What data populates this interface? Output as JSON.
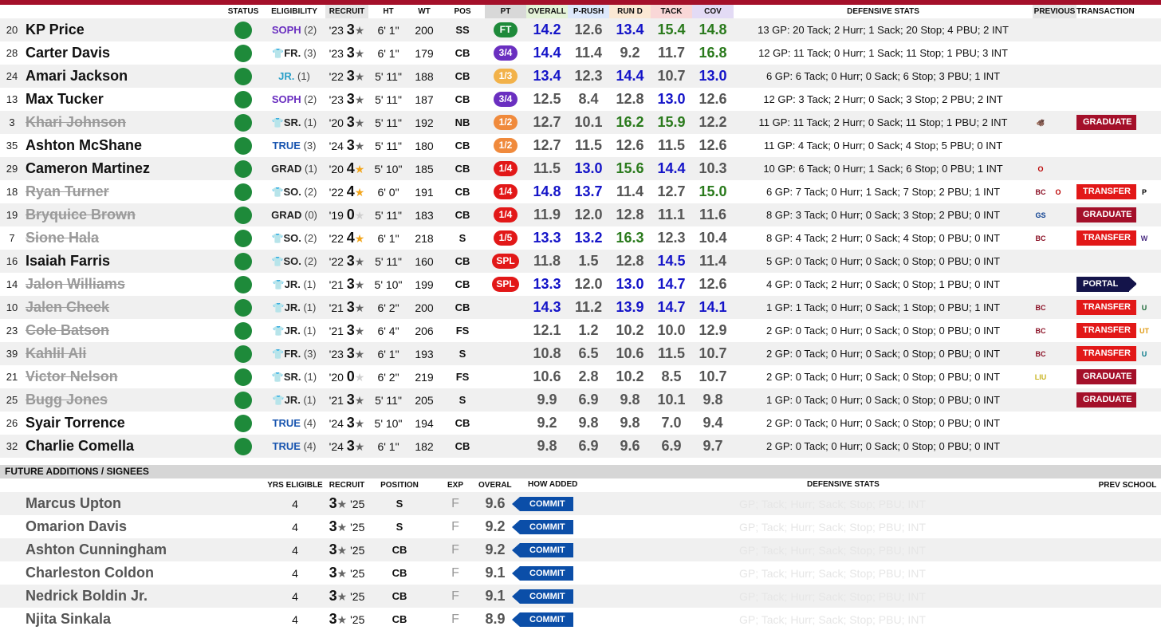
{
  "roster_headers": {
    "status": "STATUS",
    "eligibility": "ELIGIBILITY",
    "recruit": "RECRUIT",
    "ht": "HT",
    "wt": "WT",
    "pos": "POS",
    "pt": "PT",
    "overall": "OVERALL",
    "prush": "P-RUSH",
    "rund": "RUN D",
    "tack": "TACK",
    "cov": "COV",
    "defensive_stats": "DEFENSIVE STATS",
    "previous": "PREVIOUS",
    "transaction": "TRANSACTION"
  },
  "players": [
    {
      "num": "20",
      "name": "KP Price",
      "left": false,
      "elig_icon": "",
      "elig_year": "SOPH",
      "elig_cls": "soph",
      "elig_n": "(2)",
      "class": "'23",
      "rec": "3",
      "star": "g",
      "ht": "6' 1\"",
      "wt": "200",
      "pos": "SS",
      "pt": "FT",
      "pt_color": "#1e8a3a",
      "ovr": "14.2",
      "prush": "12.6",
      "rund": "13.4",
      "tack": "15.4",
      "cov": "14.8",
      "hi": [
        "ovr",
        "rund",
        "cov"
      ],
      "hig": [
        "tack",
        "cov"
      ],
      "stats": "13 GP: 20 Tack; 2 Hurr; 1 Sack; 20 Stop; 4 PBU; 2 INT",
      "prev": [],
      "tag": "",
      "tag_type": "",
      "dest": ""
    },
    {
      "num": "28",
      "name": "Carter Davis",
      "left": false,
      "elig_icon": "redshirt-icon",
      "elig_year": "FR.",
      "elig_cls": "rs",
      "elig_n": "(3)",
      "class": "'23",
      "rec": "3",
      "star": "g",
      "ht": "6' 1\"",
      "wt": "179",
      "pos": "CB",
      "pt": "3/4",
      "pt_color": "#6a2fc0",
      "ovr": "14.4",
      "prush": "11.4",
      "rund": "9.2",
      "tack": "11.7",
      "cov": "16.8",
      "hi": [
        "ovr"
      ],
      "hig": [
        "cov"
      ],
      "stats": "12 GP: 11 Tack; 0 Hurr; 1 Sack; 11 Stop; 1 PBU; 3 INT",
      "prev": [],
      "tag": "",
      "tag_type": "",
      "dest": ""
    },
    {
      "num": "24",
      "name": "Amari Jackson",
      "left": false,
      "elig_icon": "",
      "elig_year": "JR.",
      "elig_cls": "jr-plain",
      "elig_n": "(1)",
      "class": "'22",
      "rec": "3",
      "star": "g",
      "ht": "5' 11\"",
      "wt": "188",
      "pos": "CB",
      "pt": "1/3",
      "pt_color": "#f2b24a",
      "ovr": "13.4",
      "prush": "12.3",
      "rund": "14.4",
      "tack": "10.7",
      "cov": "13.0",
      "hi": [
        "ovr",
        "rund",
        "cov"
      ],
      "hig": [],
      "stats": "6 GP: 6 Tack; 0 Hurr; 0 Sack; 6 Stop; 3 PBU; 1 INT",
      "prev": [],
      "tag": "",
      "tag_type": "",
      "dest": ""
    },
    {
      "num": "13",
      "name": "Max Tucker",
      "left": false,
      "elig_icon": "",
      "elig_year": "SOPH",
      "elig_cls": "soph",
      "elig_n": "(2)",
      "class": "'23",
      "rec": "3",
      "star": "g",
      "ht": "5' 11\"",
      "wt": "187",
      "pos": "CB",
      "pt": "3/4",
      "pt_color": "#6a2fc0",
      "ovr": "12.5",
      "prush": "8.4",
      "rund": "12.8",
      "tack": "13.0",
      "cov": "12.6",
      "hi": [
        "tack"
      ],
      "hig": [],
      "stats": "12 GP: 3 Tack; 2 Hurr; 0 Sack; 3 Stop; 2 PBU; 2 INT",
      "prev": [],
      "tag": "",
      "tag_type": "",
      "dest": ""
    },
    {
      "num": "3",
      "name": "Khari Johnson",
      "left": true,
      "elig_icon": "redshirt-icon",
      "elig_year": "SR.",
      "elig_cls": "rs",
      "elig_n": "(1)",
      "class": "'20",
      "rec": "3",
      "star": "g",
      "ht": "5' 11\"",
      "wt": "192",
      "pos": "NB",
      "pt": "1/2",
      "pt_color": "#f08a3c",
      "ovr": "12.7",
      "prush": "10.1",
      "rund": "16.2",
      "tack": "15.9",
      "cov": "12.2",
      "hi": [],
      "hig": [
        "rund",
        "tack"
      ],
      "stats": "11 GP: 11 Tack; 2 Hurr; 0 Sack; 11 Stop; 1 PBU; 2 INT",
      "prev": [
        "arkansas-logo"
      ],
      "tag": "GRADUATE",
      "tag_type": "grad",
      "dest": ""
    },
    {
      "num": "35",
      "name": "Ashton McShane",
      "left": false,
      "elig_icon": "",
      "elig_year": "TRUE",
      "elig_cls": "true",
      "elig_n": "(3)",
      "class": "'24",
      "rec": "3",
      "star": "g",
      "ht": "5' 11\"",
      "wt": "180",
      "pos": "CB",
      "pt": "1/2",
      "pt_color": "#f08a3c",
      "ovr": "12.7",
      "prush": "11.5",
      "rund": "12.6",
      "tack": "11.5",
      "cov": "12.6",
      "hi": [],
      "hig": [],
      "stats": "11 GP: 4 Tack; 0 Hurr; 0 Sack; 4 Stop; 5 PBU; 0 INT",
      "prev": [],
      "tag": "",
      "tag_type": "",
      "dest": ""
    },
    {
      "num": "29",
      "name": "Cameron Martinez",
      "left": false,
      "elig_icon": "",
      "elig_year": "GRAD",
      "elig_cls": "grad",
      "elig_n": "(1)",
      "class": "'20",
      "rec": "4",
      "star": "o",
      "ht": "5' 10\"",
      "wt": "185",
      "pos": "CB",
      "pt": "1/4",
      "pt_color": "#e21818",
      "ovr": "11.5",
      "prush": "13.0",
      "rund": "15.6",
      "tack": "14.4",
      "cov": "10.3",
      "hi": [
        "prush",
        "tack"
      ],
      "hig": [
        "rund"
      ],
      "stats": "10 GP: 6 Tack; 0 Hurr; 1 Sack; 6 Stop; 0 PBU; 1 INT",
      "prev": [
        "ohio-state-logo"
      ],
      "tag": "",
      "tag_type": "",
      "dest": ""
    },
    {
      "num": "18",
      "name": "Ryan Turner",
      "left": true,
      "elig_icon": "redshirt-icon",
      "elig_year": "SO.",
      "elig_cls": "rs",
      "elig_n": "(2)",
      "class": "'22",
      "rec": "4",
      "star": "o",
      "ht": "6' 0\"",
      "wt": "191",
      "pos": "CB",
      "pt": "1/4",
      "pt_color": "#e21818",
      "ovr": "14.8",
      "prush": "13.7",
      "rund": "11.4",
      "tack": "12.7",
      "cov": "15.0",
      "hi": [
        "ovr",
        "prush"
      ],
      "hig": [
        "cov"
      ],
      "stats": "6 GP: 7 Tack; 0 Hurr; 1 Sack; 7 Stop; 2 PBU; 1 INT",
      "prev": [
        "boston-college-logo",
        "ohio-state-logo"
      ],
      "tag": "TRANSFER",
      "tag_type": "trans",
      "dest": "purdue-logo"
    },
    {
      "num": "19",
      "name": "Bryquice Brown",
      "left": true,
      "elig_icon": "",
      "elig_year": "GRAD",
      "elig_cls": "grad",
      "elig_n": "(0)",
      "class": "'19",
      "rec": "0",
      "star": "l",
      "ht": "5' 11\"",
      "wt": "183",
      "pos": "CB",
      "pt": "1/4",
      "pt_color": "#e21818",
      "ovr": "11.9",
      "prush": "12.0",
      "rund": "12.8",
      "tack": "11.1",
      "cov": "11.6",
      "hi": [],
      "hig": [],
      "stats": "8 GP: 3 Tack; 0 Hurr; 0 Sack; 3 Stop; 2 PBU; 0 INT",
      "prev": [
        "georgia-state-logo"
      ],
      "tag": "GRADUATE",
      "tag_type": "grad",
      "dest": ""
    },
    {
      "num": "7",
      "name": "Sione Hala",
      "left": true,
      "elig_icon": "redshirt-icon",
      "elig_year": "SO.",
      "elig_cls": "rs",
      "elig_n": "(2)",
      "class": "'22",
      "rec": "4",
      "star": "o",
      "ht": "6' 1\"",
      "wt": "218",
      "pos": "S",
      "pt": "1/5",
      "pt_color": "#e21818",
      "ovr": "13.3",
      "prush": "13.2",
      "rund": "16.3",
      "tack": "12.3",
      "cov": "10.4",
      "hi": [
        "ovr",
        "prush"
      ],
      "hig": [
        "rund"
      ],
      "stats": "8 GP: 4 Tack; 2 Hurr; 0 Sack; 4 Stop; 0 PBU; 0 INT",
      "prev": [
        "boston-college-logo"
      ],
      "tag": "TRANSFER",
      "tag_type": "trans",
      "dest": "weber-state-logo"
    },
    {
      "num": "16",
      "name": "Isaiah Farris",
      "left": false,
      "elig_icon": "redshirt-icon",
      "elig_year": "SO.",
      "elig_cls": "rs",
      "elig_n": "(2)",
      "class": "'22",
      "rec": "3",
      "star": "g",
      "ht": "5' 11\"",
      "wt": "160",
      "pos": "CB",
      "pt": "SPL",
      "pt_color": "#e21818",
      "ovr": "11.8",
      "prush": "1.5",
      "rund": "12.8",
      "tack": "14.5",
      "cov": "11.4",
      "hi": [
        "tack"
      ],
      "hig": [],
      "stats": "5 GP: 0 Tack; 0 Hurr; 0 Sack; 0 Stop; 0 PBU; 0 INT",
      "prev": [],
      "tag": "",
      "tag_type": "",
      "dest": ""
    },
    {
      "num": "14",
      "name": "Jalon Williams",
      "left": true,
      "elig_icon": "redshirt-icon",
      "elig_year": "JR.",
      "elig_cls": "rs",
      "elig_n": "(1)",
      "class": "'21",
      "rec": "3",
      "star": "g",
      "ht": "5' 10\"",
      "wt": "199",
      "pos": "CB",
      "pt": "SPL",
      "pt_color": "#e21818",
      "ovr": "13.3",
      "prush": "12.0",
      "rund": "13.0",
      "tack": "14.7",
      "cov": "12.6",
      "hi": [
        "ovr",
        "rund",
        "tack"
      ],
      "hig": [],
      "stats": "4 GP: 0 Tack; 2 Hurr; 0 Sack; 0 Stop; 1 PBU; 0 INT",
      "prev": [],
      "tag": "PORTAL",
      "tag_type": "portal",
      "dest": ""
    },
    {
      "num": "10",
      "name": "Jalen Cheek",
      "left": true,
      "elig_icon": "redshirt-icon",
      "elig_year": "JR.",
      "elig_cls": "rs",
      "elig_n": "(1)",
      "class": "'21",
      "rec": "3",
      "star": "g",
      "ht": "6' 2\"",
      "wt": "200",
      "pos": "CB",
      "pt": "",
      "pt_color": "",
      "ovr": "14.3",
      "prush": "11.2",
      "rund": "13.9",
      "tack": "14.7",
      "cov": "14.1",
      "hi": [
        "ovr",
        "rund",
        "tack",
        "cov"
      ],
      "hig": [],
      "stats": "1 GP: 1 Tack; 0 Hurr; 0 Sack; 1 Stop; 0 PBU; 1 INT",
      "prev": [
        "boston-college-logo"
      ],
      "tag": "TRANSFER",
      "tag_type": "trans",
      "dest": "uab-logo"
    },
    {
      "num": "23",
      "name": "Cole Batson",
      "left": true,
      "elig_icon": "redshirt-icon",
      "elig_year": "JR.",
      "elig_cls": "rs",
      "elig_n": "(1)",
      "class": "'21",
      "rec": "3",
      "star": "g",
      "ht": "6' 4\"",
      "wt": "206",
      "pos": "FS",
      "pt": "",
      "pt_color": "",
      "ovr": "12.1",
      "prush": "1.2",
      "rund": "10.2",
      "tack": "10.0",
      "cov": "12.9",
      "hi": [],
      "hig": [],
      "stats": "2 GP: 0 Tack; 0 Hurr; 0 Sack; 0 Stop; 0 PBU; 0 INT",
      "prev": [
        "boston-college-logo"
      ],
      "tag": "TRANSFER",
      "tag_type": "trans",
      "dest": "ut-martin-logo"
    },
    {
      "num": "39",
      "name": "Kahlil Ali",
      "left": true,
      "elig_icon": "redshirt-icon",
      "elig_year": "FR.",
      "elig_cls": "rs",
      "elig_n": "(3)",
      "class": "'23",
      "rec": "3",
      "star": "g",
      "ht": "6' 1\"",
      "wt": "193",
      "pos": "S",
      "pt": "",
      "pt_color": "",
      "ovr": "10.8",
      "prush": "6.5",
      "rund": "10.6",
      "tack": "11.5",
      "cov": "10.7",
      "hi": [],
      "hig": [],
      "stats": "2 GP: 0 Tack; 0 Hurr; 0 Sack; 0 Stop; 0 PBU; 0 INT",
      "prev": [
        "boston-college-logo"
      ],
      "tag": "TRANSFER",
      "tag_type": "trans",
      "dest": "uncw-logo"
    },
    {
      "num": "21",
      "name": "Victor Nelson",
      "left": true,
      "elig_icon": "redshirt-icon",
      "elig_year": "SR.",
      "elig_cls": "rs",
      "elig_n": "(1)",
      "class": "'20",
      "rec": "0",
      "star": "l",
      "ht": "6' 2\"",
      "wt": "219",
      "pos": "FS",
      "pt": "",
      "pt_color": "",
      "ovr": "10.6",
      "prush": "2.8",
      "rund": "10.2",
      "tack": "8.5",
      "cov": "10.7",
      "hi": [],
      "hig": [],
      "stats": "2 GP: 0 Tack; 0 Hurr; 0 Sack; 0 Stop; 0 PBU; 0 INT",
      "prev": [
        "liu-logo"
      ],
      "tag": "GRADUATE",
      "tag_type": "grad",
      "dest": ""
    },
    {
      "num": "25",
      "name": "Bugg Jones",
      "left": true,
      "elig_icon": "redshirt-icon",
      "elig_year": "JR.",
      "elig_cls": "rs",
      "elig_n": "(1)",
      "class": "'21",
      "rec": "3",
      "star": "g",
      "ht": "5' 11\"",
      "wt": "205",
      "pos": "S",
      "pt": "",
      "pt_color": "",
      "ovr": "9.9",
      "prush": "6.9",
      "rund": "9.8",
      "tack": "10.1",
      "cov": "9.8",
      "hi": [],
      "hig": [],
      "stats": "1 GP: 0 Tack; 0 Hurr; 0 Sack; 0 Stop; 0 PBU; 0 INT",
      "prev": [],
      "tag": "GRADUATE",
      "tag_type": "grad",
      "dest": ""
    },
    {
      "num": "26",
      "name": "Syair Torrence",
      "left": false,
      "elig_icon": "",
      "elig_year": "TRUE",
      "elig_cls": "true",
      "elig_n": "(4)",
      "class": "'24",
      "rec": "3",
      "star": "g",
      "ht": "5' 10\"",
      "wt": "194",
      "pos": "CB",
      "pt": "",
      "pt_color": "",
      "ovr": "9.2",
      "prush": "9.8",
      "rund": "9.8",
      "tack": "7.0",
      "cov": "9.4",
      "hi": [],
      "hig": [],
      "stats": "2 GP: 0 Tack; 0 Hurr; 0 Sack; 0 Stop; 0 PBU; 0 INT",
      "prev": [],
      "tag": "",
      "tag_type": "",
      "dest": ""
    },
    {
      "num": "32",
      "name": "Charlie Comella",
      "left": false,
      "elig_icon": "",
      "elig_year": "TRUE",
      "elig_cls": "true",
      "elig_n": "(4)",
      "class": "'24",
      "rec": "3",
      "star": "g",
      "ht": "6' 1\"",
      "wt": "182",
      "pos": "CB",
      "pt": "",
      "pt_color": "",
      "ovr": "9.8",
      "prush": "6.9",
      "rund": "9.6",
      "tack": "6.9",
      "cov": "9.7",
      "hi": [],
      "hig": [],
      "stats": "2 GP: 0 Tack; 0 Hurr; 0 Sack; 0 Stop; 0 PBU; 0 INT",
      "prev": [],
      "tag": "",
      "tag_type": "",
      "dest": ""
    }
  ],
  "future_section": {
    "title": "FUTURE ADDITIONS / SIGNEES",
    "headers": {
      "yrs_eligible": "YRS ELIGIBLE",
      "recruit": "RECRUIT",
      "position": "POSITION",
      "exp": "EXP",
      "overall": "OVERALL",
      "how_added": "HOW ADDED",
      "defensive_stats": "DEFENSIVE STATS",
      "prev_school": "PREV SCHOOL"
    },
    "ghost_stats": "GP;  Tack;  Hurr;  Sack;  Stop;  PBU;  INT",
    "signees": [
      {
        "name": "Marcus Upton",
        "yrs": "4",
        "rec": "3",
        "class": "'25",
        "pos": "S",
        "exp": "F",
        "ovr": "9.6",
        "how": "COMMIT"
      },
      {
        "name": "Omarion Davis",
        "yrs": "4",
        "rec": "3",
        "class": "'25",
        "pos": "S",
        "exp": "F",
        "ovr": "9.2",
        "how": "COMMIT"
      },
      {
        "name": "Ashton Cunningham",
        "yrs": "4",
        "rec": "3",
        "class": "'25",
        "pos": "CB",
        "exp": "F",
        "ovr": "9.2",
        "how": "COMMIT"
      },
      {
        "name": "Charleston Coldon",
        "yrs": "4",
        "rec": "3",
        "class": "'25",
        "pos": "CB",
        "exp": "F",
        "ovr": "9.1",
        "how": "COMMIT"
      },
      {
        "name": "Nedrick Boldin Jr.",
        "yrs": "4",
        "rec": "3",
        "class": "'25",
        "pos": "CB",
        "exp": "F",
        "ovr": "9.1",
        "how": "COMMIT"
      },
      {
        "name": "Njita Sinkala",
        "yrs": "4",
        "rec": "3",
        "class": "'25",
        "pos": "CB",
        "exp": "F",
        "ovr": "8.9",
        "how": "COMMIT"
      }
    ]
  },
  "colors": {
    "accent_bar": "#a4102a",
    "status_active": "#1e8a3a",
    "high_blue": "#1414c8",
    "high_green": "#2a7a1c",
    "commit_blue": "#0b4ea8"
  },
  "logo_glyphs": {
    "arkansas-logo": {
      "text": "🐗",
      "color": "#a4102a"
    },
    "ohio-state-logo": {
      "text": "O",
      "color": "#bb0000"
    },
    "boston-college-logo": {
      "text": "BC",
      "color": "#8a0f24"
    },
    "georgia-state-logo": {
      "text": "GS",
      "color": "#0a3d8f"
    },
    "liu-logo": {
      "text": "LIU",
      "color": "#c9b422"
    },
    "purdue-logo": {
      "text": "P",
      "color": "#000000"
    },
    "weber-state-logo": {
      "text": "W",
      "color": "#4b2e83"
    },
    "uab-logo": {
      "text": "U",
      "color": "#1e6b3a"
    },
    "ut-martin-logo": {
      "text": "UT",
      "color": "#e09a12"
    },
    "uncw-logo": {
      "text": "U",
      "color": "#0a7a8a"
    }
  }
}
